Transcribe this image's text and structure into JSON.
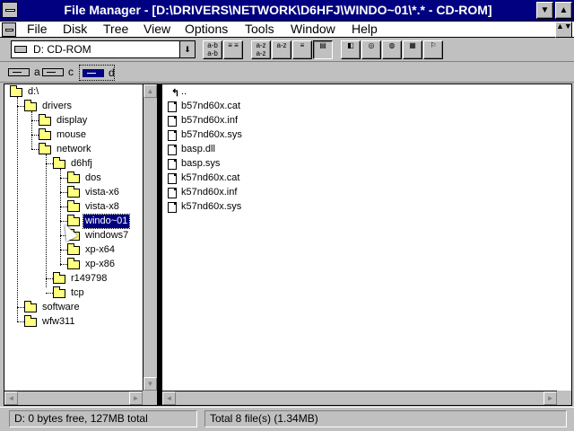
{
  "window": {
    "title": "File Manager - [D:\\DRIVERS\\NETWORK\\D6HFJ\\WINDO~01\\*.* - CD-ROM]",
    "minimize_glyph": "▼",
    "maximize_glyph": "▲",
    "restore_glyph": "▲▼"
  },
  "menu": [
    "File",
    "Disk",
    "Tree",
    "View",
    "Options",
    "Tools",
    "Window",
    "Help"
  ],
  "toolbar": {
    "drive_select": "D: CD-ROM",
    "dropdown_glyph": "⬇",
    "buttons": [
      {
        "icon": "connect-drive-icon",
        "glyph": "a-b a-b"
      },
      {
        "icon": "disconnect-drive-icon",
        "glyph": "≡ ≡"
      },
      {
        "icon": "sort-by-name-icon",
        "glyph": "a-z a-z"
      },
      {
        "icon": "sort-by-type-icon",
        "glyph": "a-z"
      },
      {
        "icon": "sort-by-size-icon",
        "glyph": "≡"
      },
      {
        "icon": "sort-by-date-icon",
        "glyph": "▤"
      },
      {
        "icon": "share-as-icon",
        "glyph": "◧"
      },
      {
        "icon": "stop-sharing-icon",
        "glyph": "◎"
      },
      {
        "icon": "new-window-icon",
        "glyph": "◍"
      },
      {
        "icon": "properties-icon",
        "glyph": "▦"
      },
      {
        "icon": "run-icon",
        "glyph": "⚐"
      }
    ]
  },
  "drives": [
    {
      "letter": "a",
      "icon": "floppy-drive-icon",
      "active": false
    },
    {
      "letter": "c",
      "icon": "hard-drive-icon",
      "active": false
    },
    {
      "letter": "d",
      "icon": "cdrom-drive-icon",
      "active": true
    }
  ],
  "tree": [
    {
      "label": "d:\\",
      "level": 0
    },
    {
      "label": "drivers",
      "level": 1
    },
    {
      "label": "display",
      "level": 2
    },
    {
      "label": "mouse",
      "level": 2
    },
    {
      "label": "network",
      "level": 2
    },
    {
      "label": "d6hfj",
      "level": 3
    },
    {
      "label": "dos",
      "level": 4
    },
    {
      "label": "vista-x6",
      "level": 4
    },
    {
      "label": "vista-x8",
      "level": 4
    },
    {
      "label": "windo~01",
      "level": 4,
      "selected": true
    },
    {
      "label": "windows7",
      "level": 4
    },
    {
      "label": "xp-x64",
      "level": 4
    },
    {
      "label": "xp-x86",
      "level": 4
    },
    {
      "label": "r149798",
      "level": 3
    },
    {
      "label": "tcp",
      "level": 3
    },
    {
      "label": "software",
      "level": 1
    },
    {
      "label": "wfw311",
      "level": 1
    }
  ],
  "files": {
    "parent_label": "..",
    "items": [
      "b57nd60x.cat",
      "b57nd60x.inf",
      "b57nd60x.sys",
      "basp.dll",
      "basp.sys",
      "k57nd60x.cat",
      "k57nd60x.inf",
      "k57nd60x.sys"
    ]
  },
  "scroll": {
    "up": "▲",
    "down": "▼",
    "left": "◄",
    "right": "►"
  },
  "status": {
    "disk": "D: 0 bytes free,  127MB total",
    "selection": "Total 8 file(s) (1.34MB)"
  }
}
